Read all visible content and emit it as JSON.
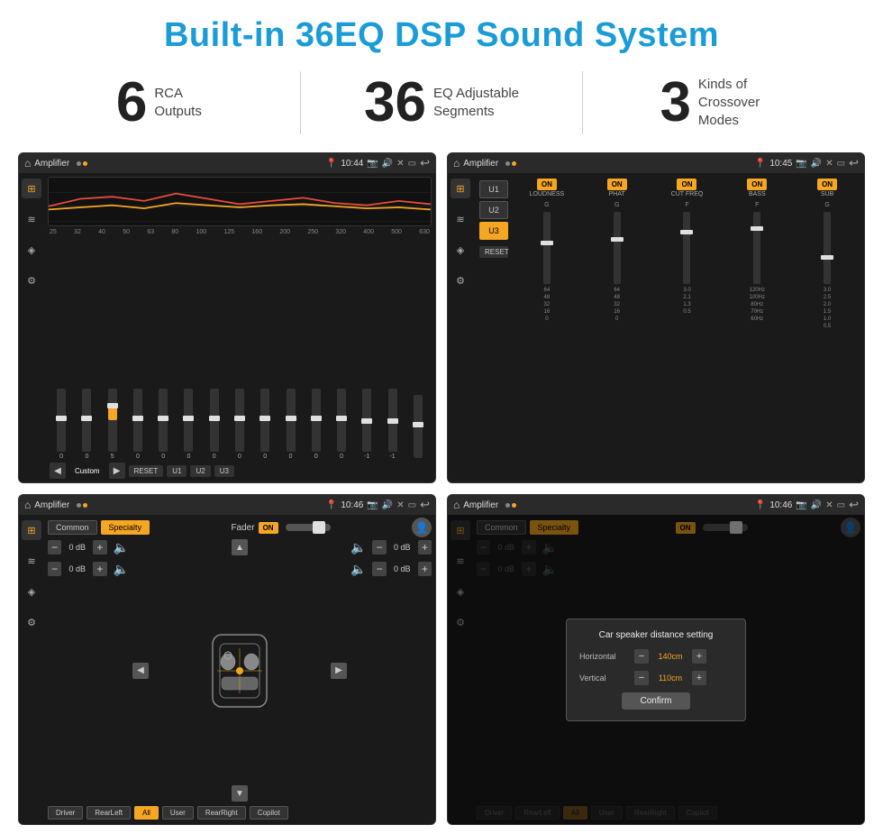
{
  "title": "Built-in 36EQ DSP Sound System",
  "stats": [
    {
      "number": "6",
      "label": "RCA\nOutputs"
    },
    {
      "number": "36",
      "label": "EQ Adjustable\nSegments"
    },
    {
      "number": "3",
      "label": "Kinds of\nCrossover Modes"
    }
  ],
  "screens": {
    "screen1": {
      "app_title": "Amplifier",
      "time": "10:44",
      "eq_freqs": [
        "25",
        "32",
        "40",
        "50",
        "63",
        "80",
        "100",
        "125",
        "160",
        "200",
        "250",
        "320",
        "400",
        "500",
        "630"
      ],
      "eq_values": [
        "0",
        "0",
        "5",
        "0",
        "0",
        "0",
        "0",
        "0",
        "0",
        "0",
        "0",
        "0",
        "-1",
        "-1"
      ],
      "bottom_buttons": [
        "◀",
        "Custom",
        "▶",
        "RESET",
        "U1",
        "U2",
        "U3"
      ]
    },
    "screen2": {
      "app_title": "Amplifier",
      "time": "10:45",
      "u_buttons": [
        "U1",
        "U2",
        "U3"
      ],
      "selected_u": "U3",
      "columns": [
        "LOUDNESS",
        "PHAT",
        "CUT FREQ",
        "BASS",
        "SUB"
      ],
      "reset_btn": "RESET"
    },
    "screen3": {
      "app_title": "Amplifier",
      "time": "10:46",
      "tabs": [
        "Common",
        "Specialty"
      ],
      "active_tab": "Specialty",
      "fader_label": "Fader",
      "fader_on": "ON",
      "db_values": [
        "0 dB",
        "0 dB",
        "0 dB",
        "0 dB"
      ],
      "bottom_buttons": [
        "Driver",
        "RearLeft",
        "All",
        "User",
        "RearRight",
        "Copilot"
      ]
    },
    "screen4": {
      "app_title": "Amplifier",
      "time": "10:46",
      "dialog": {
        "title": "Car speaker distance setting",
        "horizontal_label": "Horizontal",
        "horizontal_value": "140cm",
        "vertical_label": "Vertical",
        "vertical_value": "110cm",
        "confirm_btn": "Confirm"
      },
      "db_values": [
        "0 dB",
        "0 dB"
      ],
      "bottom_buttons": [
        "Driver",
        "RearLeft",
        "All",
        "User",
        "RearRight",
        "Copilot"
      ]
    }
  },
  "icons": {
    "home": "⌂",
    "back": "↩",
    "eq_icon": "♫",
    "wave_icon": "≈",
    "speaker_icon": "◈",
    "settings_icon": "⚙"
  }
}
